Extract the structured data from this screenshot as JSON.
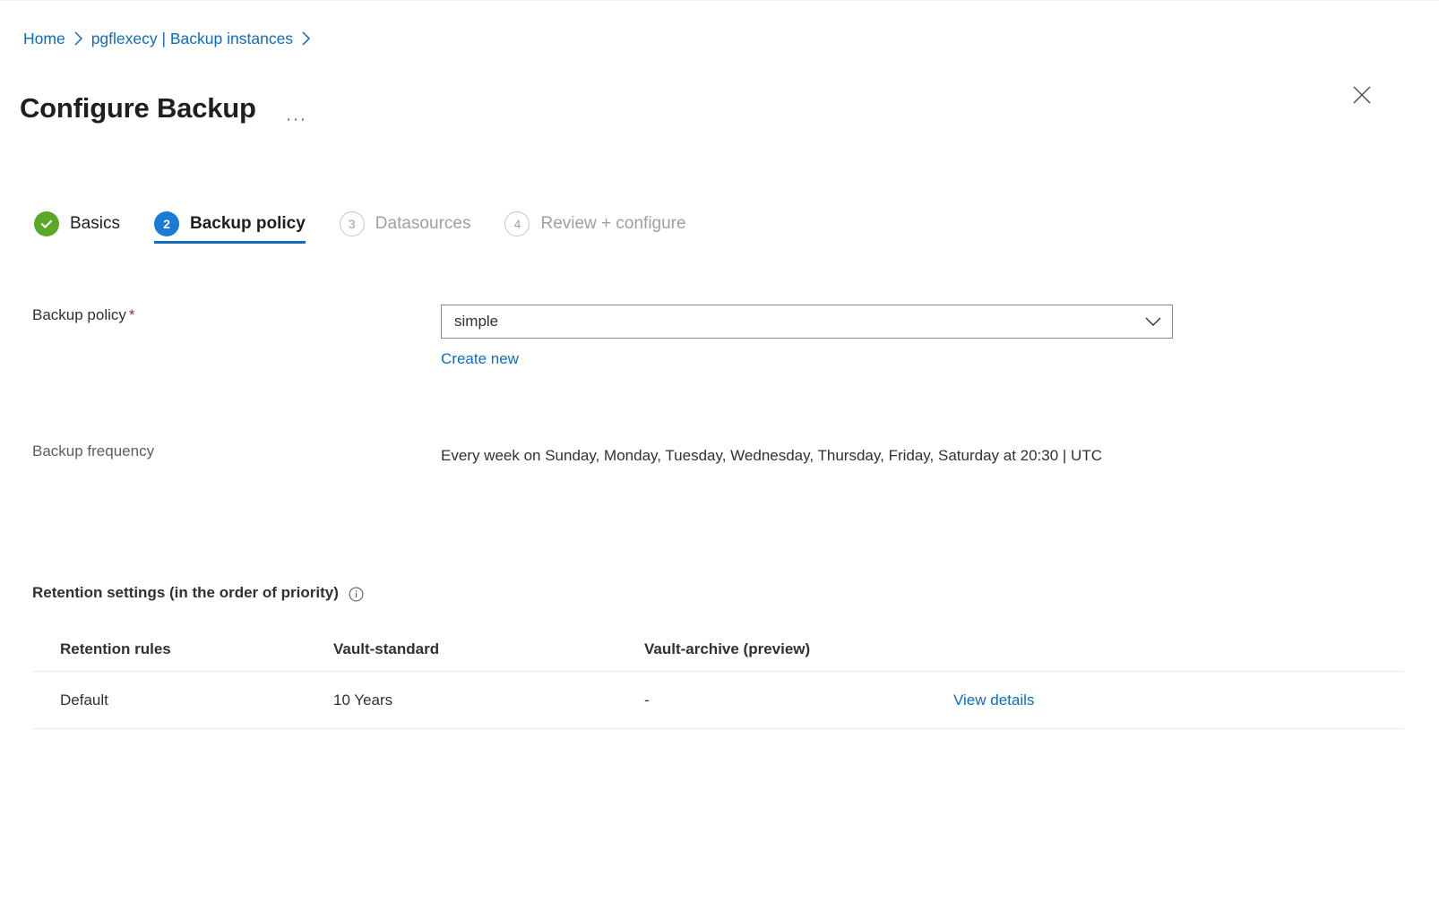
{
  "breadcrumb": {
    "items": [
      {
        "label": "Home"
      },
      {
        "label": "pgflexecy | Backup instances"
      }
    ],
    "separator_icon": "chevron-right-icon"
  },
  "header": {
    "title": "Configure Backup",
    "more_label": "···",
    "more_icon": "ellipsis-icon",
    "close_icon": "close-icon"
  },
  "wizard": {
    "steps": [
      {
        "number": "",
        "label": "Basics",
        "state": "completed",
        "icon": "check-icon"
      },
      {
        "number": "2",
        "label": "Backup policy",
        "state": "active"
      },
      {
        "number": "3",
        "label": "Datasources",
        "state": "disabled"
      },
      {
        "number": "4",
        "label": "Review + configure",
        "state": "disabled"
      }
    ]
  },
  "form": {
    "backup_policy": {
      "label": "Backup policy",
      "required_mark": "*",
      "value": "simple",
      "chevron_icon": "chevron-down-icon",
      "create_new_label": "Create new"
    },
    "backup_frequency": {
      "label": "Backup frequency",
      "value": "Every week on Sunday, Monday, Tuesday, Wednesday, Thursday, Friday, Saturday at 20:30 | UTC"
    }
  },
  "retention": {
    "heading": "Retention settings (in the order of priority)",
    "info_icon": "info-icon",
    "columns": [
      "Retention rules",
      "Vault-standard",
      "Vault-archive (preview)",
      ""
    ],
    "rows": [
      {
        "rule": "Default",
        "vault_standard": "10 Years",
        "vault_archive": "-",
        "action": "View details"
      }
    ]
  },
  "colors": {
    "accent_blue": "#0f6cbd",
    "active_badge": "#1b7ad6",
    "success_green": "#5ba829",
    "required_red": "#a4262c",
    "muted_text": "#a19f9d",
    "divider": "#edebe9"
  }
}
